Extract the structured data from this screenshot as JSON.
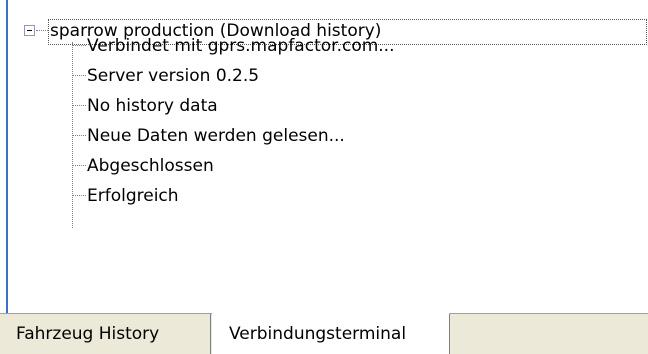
{
  "tree": {
    "root_label": "sparrow production (Download history)",
    "children": [
      "Verbindet mit gprs.mapfactor.com...",
      "Server version 0.2.5",
      "No history data",
      "Neue Daten werden gelesen...",
      "Abgeschlossen",
      "Erfolgreich"
    ]
  },
  "tabs": [
    {
      "label": "Fahrzeug History",
      "selected": false
    },
    {
      "label": "Verbindungsterminal",
      "selected": true
    }
  ],
  "colors": {
    "accent_border": "#3c6fc9",
    "tab_background": "#ece9d8"
  }
}
